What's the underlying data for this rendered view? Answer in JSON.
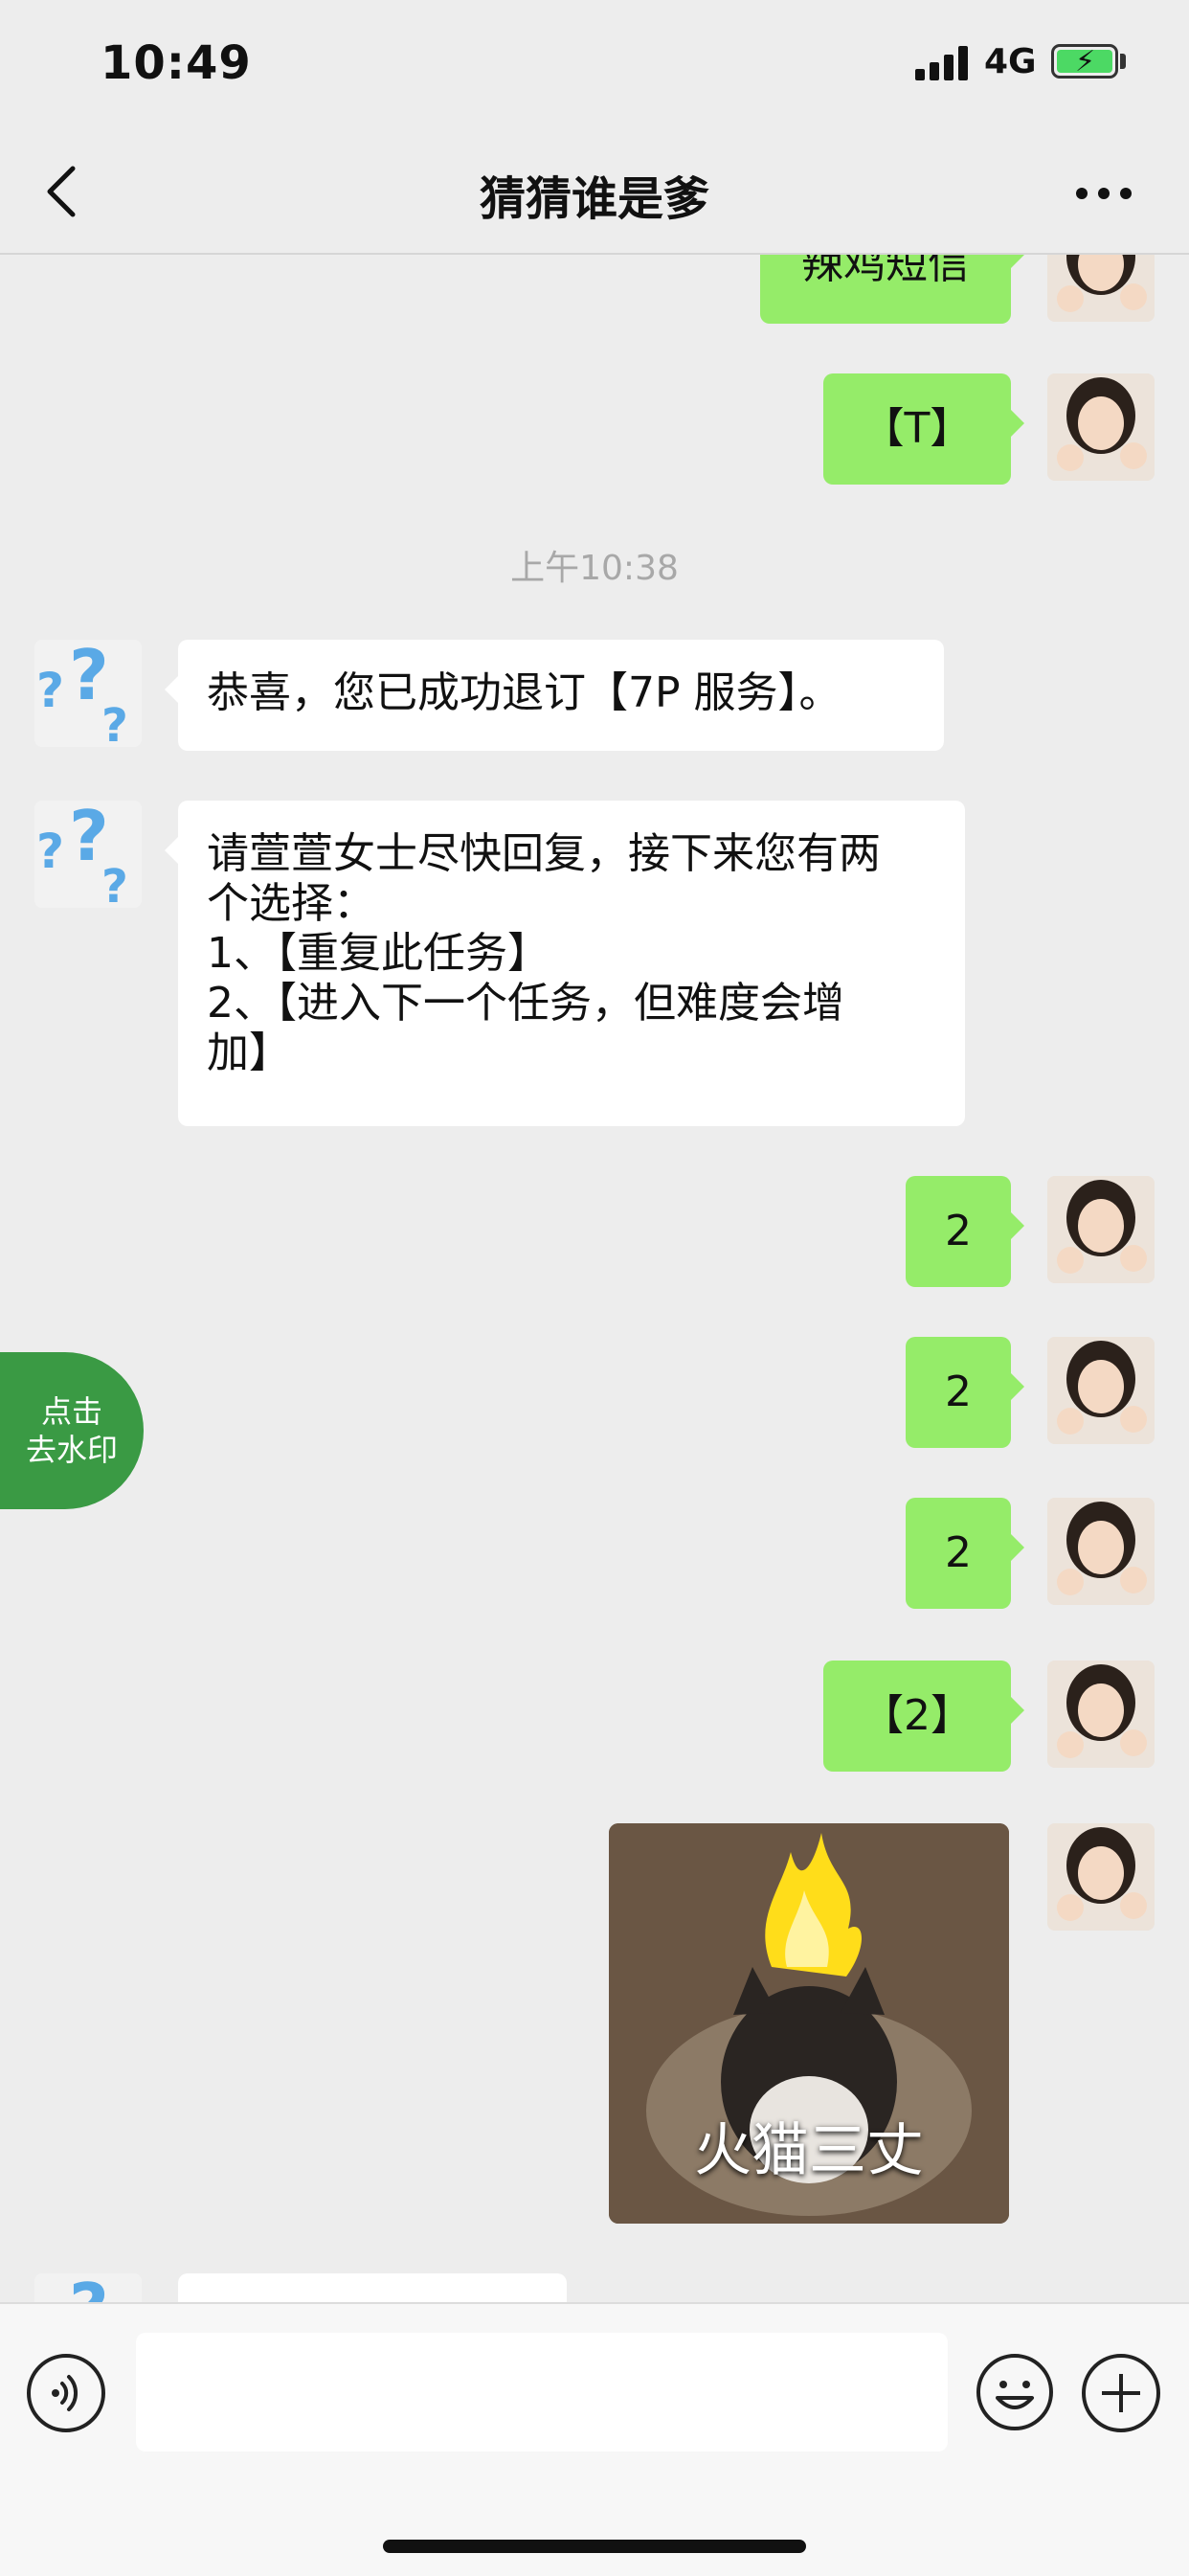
{
  "status_bar": {
    "time": "10:49",
    "network": "4G"
  },
  "header": {
    "title": "猜猜谁是爹"
  },
  "messages": {
    "m0": {
      "text": "辣鸡短信"
    },
    "m1": {
      "text": "【T】"
    },
    "timestamp": "上午10:38",
    "m2": {
      "text": "恭喜，您已成功退订【7P 服务】。"
    },
    "m3": {
      "lines": [
        "请萱萱女士尽快回复，接下来您有两",
        "个选择：",
        "1、【重复此任务】",
        "2、【进入下一个任务，但难度会增",
        "加】"
      ]
    },
    "m4": {
      "text": "2"
    },
    "m5": {
      "text": "2"
    },
    "m6": {
      "text": "2"
    },
    "m7": {
      "text": "【2】"
    },
    "sticker": {
      "caption": "火猫三丈"
    }
  },
  "floating_button": {
    "line1": "点击",
    "line2": "去水印"
  },
  "colors": {
    "outgoing_bubble": "#95ec69",
    "incoming_bubble": "#ffffff",
    "background": "#ededed",
    "floating_button": "#3a9a44"
  },
  "icons": {
    "back": "chevron-left-icon",
    "more": "more-dots-icon",
    "voice": "voice-icon",
    "emoji": "emoji-icon",
    "plus": "plus-icon",
    "battery": "battery-charging-icon",
    "signal": "signal-icon"
  }
}
